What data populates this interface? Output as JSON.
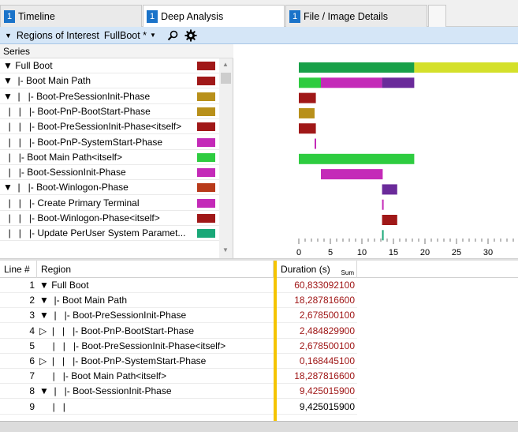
{
  "tabs": [
    {
      "num": "1",
      "label": "Timeline"
    },
    {
      "num": "1",
      "label": "Deep Analysis"
    },
    {
      "num": "1",
      "label": "File / Image Details"
    }
  ],
  "toolbar": {
    "regions_label": "Regions of Interest",
    "preset": "FullBoot *"
  },
  "series": {
    "header": "Series",
    "rows": [
      {
        "label": "▼ Full Boot",
        "color": "#a01818"
      },
      {
        "label": "▼  |- Boot Main Path",
        "color": "#a01818"
      },
      {
        "label": "▼  |   |- Boot-PreSessionInit-Phase",
        "color": "#b8901a"
      },
      {
        "label": "  |   |   |- Boot-PnP-BootStart-Phase",
        "color": "#b8901a"
      },
      {
        "label": "  |   |   |- Boot-PreSessionInit-Phase<itself>",
        "color": "#a01818"
      },
      {
        "label": "  |   |   |- Boot-PnP-SystemStart-Phase",
        "color": "#c42ab8"
      },
      {
        "label": "  |   |- Boot Main Path<itself>",
        "color": "#2ecc40"
      },
      {
        "label": "  |   |- Boot-SessionInit-Phase",
        "color": "#c42ab8"
      },
      {
        "label": "▼  |   |- Boot-Winlogon-Phase",
        "color": "#b83a1a"
      },
      {
        "label": "  |   |   |- Create Primary Terminal",
        "color": "#c42ab8"
      },
      {
        "label": "  |   |   |- Boot-Winlogon-Phase<itself>",
        "color": "#a01818"
      },
      {
        "label": "  |   |   |- Update PerUser System Paramet...",
        "color": "#1aa878"
      }
    ]
  },
  "chart_data": {
    "type": "bar",
    "orientation": "horizontal-gantt",
    "xlim": [
      0,
      35
    ],
    "ticks": [
      "0",
      "5",
      "10",
      "15",
      "20",
      "25",
      "30"
    ],
    "bars": [
      {
        "row": 0,
        "segments": [
          {
            "start": 0,
            "end": 18.3,
            "color": "#18a048"
          },
          {
            "start": 18.3,
            "end": 35,
            "color": "#d4e02a"
          }
        ]
      },
      {
        "row": 1,
        "segments": [
          {
            "start": 0,
            "end": 3.5,
            "color": "#2ecc40"
          },
          {
            "start": 3.5,
            "end": 13.2,
            "color": "#c42ab8"
          },
          {
            "start": 13.2,
            "end": 18.3,
            "color": "#6a2a9a"
          }
        ]
      },
      {
        "row": 2,
        "segments": [
          {
            "start": 0,
            "end": 2.7,
            "color": "#a01818"
          }
        ]
      },
      {
        "row": 3,
        "segments": [
          {
            "start": 0,
            "end": 2.5,
            "color": "#b8901a"
          }
        ]
      },
      {
        "row": 4,
        "segments": [
          {
            "start": 0,
            "end": 2.7,
            "color": "#a01818"
          }
        ]
      },
      {
        "row": 5,
        "segments": [
          {
            "start": 2.5,
            "end": 2.7,
            "color": "#c42ab8"
          }
        ]
      },
      {
        "row": 6,
        "segments": [
          {
            "start": 0,
            "end": 18.3,
            "color": "#2ecc40"
          }
        ]
      },
      {
        "row": 7,
        "segments": [
          {
            "start": 3.5,
            "end": 13.3,
            "color": "#c42ab8"
          }
        ]
      },
      {
        "row": 8,
        "segments": [
          {
            "start": 13.2,
            "end": 15.6,
            "color": "#6a2a9a"
          }
        ]
      },
      {
        "row": 9,
        "segments": [
          {
            "start": 13.2,
            "end": 13.3,
            "color": "#c42ab8"
          }
        ]
      },
      {
        "row": 10,
        "segments": [
          {
            "start": 13.2,
            "end": 15.6,
            "color": "#a01818"
          }
        ]
      },
      {
        "row": 11,
        "segments": [
          {
            "start": 13.2,
            "end": 13.3,
            "color": "#1aa878"
          }
        ]
      }
    ]
  },
  "table": {
    "headers": [
      "Line #",
      "Region",
      "Duration (s)"
    ],
    "duration_sub": "Sum",
    "rows": [
      {
        "line": "1",
        "region": "▼ Full Boot",
        "duration": "60,833092100"
      },
      {
        "line": "2",
        "region": "▼  |- Boot Main Path",
        "duration": "18,287816600"
      },
      {
        "line": "3",
        "region": "▼  |   |- Boot-PreSessionInit-Phase",
        "duration": "2,678500100"
      },
      {
        "line": "4",
        "region": "▷  |   |   |- Boot-PnP-BootStart-Phase",
        "duration": "2,484829900"
      },
      {
        "line": "5",
        "region": "     |   |   |- Boot-PreSessionInit-Phase<itself>",
        "duration": "2,678500100"
      },
      {
        "line": "6",
        "region": "▷  |   |   |- Boot-PnP-SystemStart-Phase",
        "duration": "0,168445100"
      },
      {
        "line": "7",
        "region": "     |   |- Boot Main Path<itself>",
        "duration": "18,287816600"
      },
      {
        "line": "8",
        "region": "▼  |   |- Boot-SessionInit-Phase",
        "duration": "9,425015900"
      },
      {
        "line": "9",
        "region": "     |   |",
        "duration": "9,425015900"
      }
    ]
  }
}
